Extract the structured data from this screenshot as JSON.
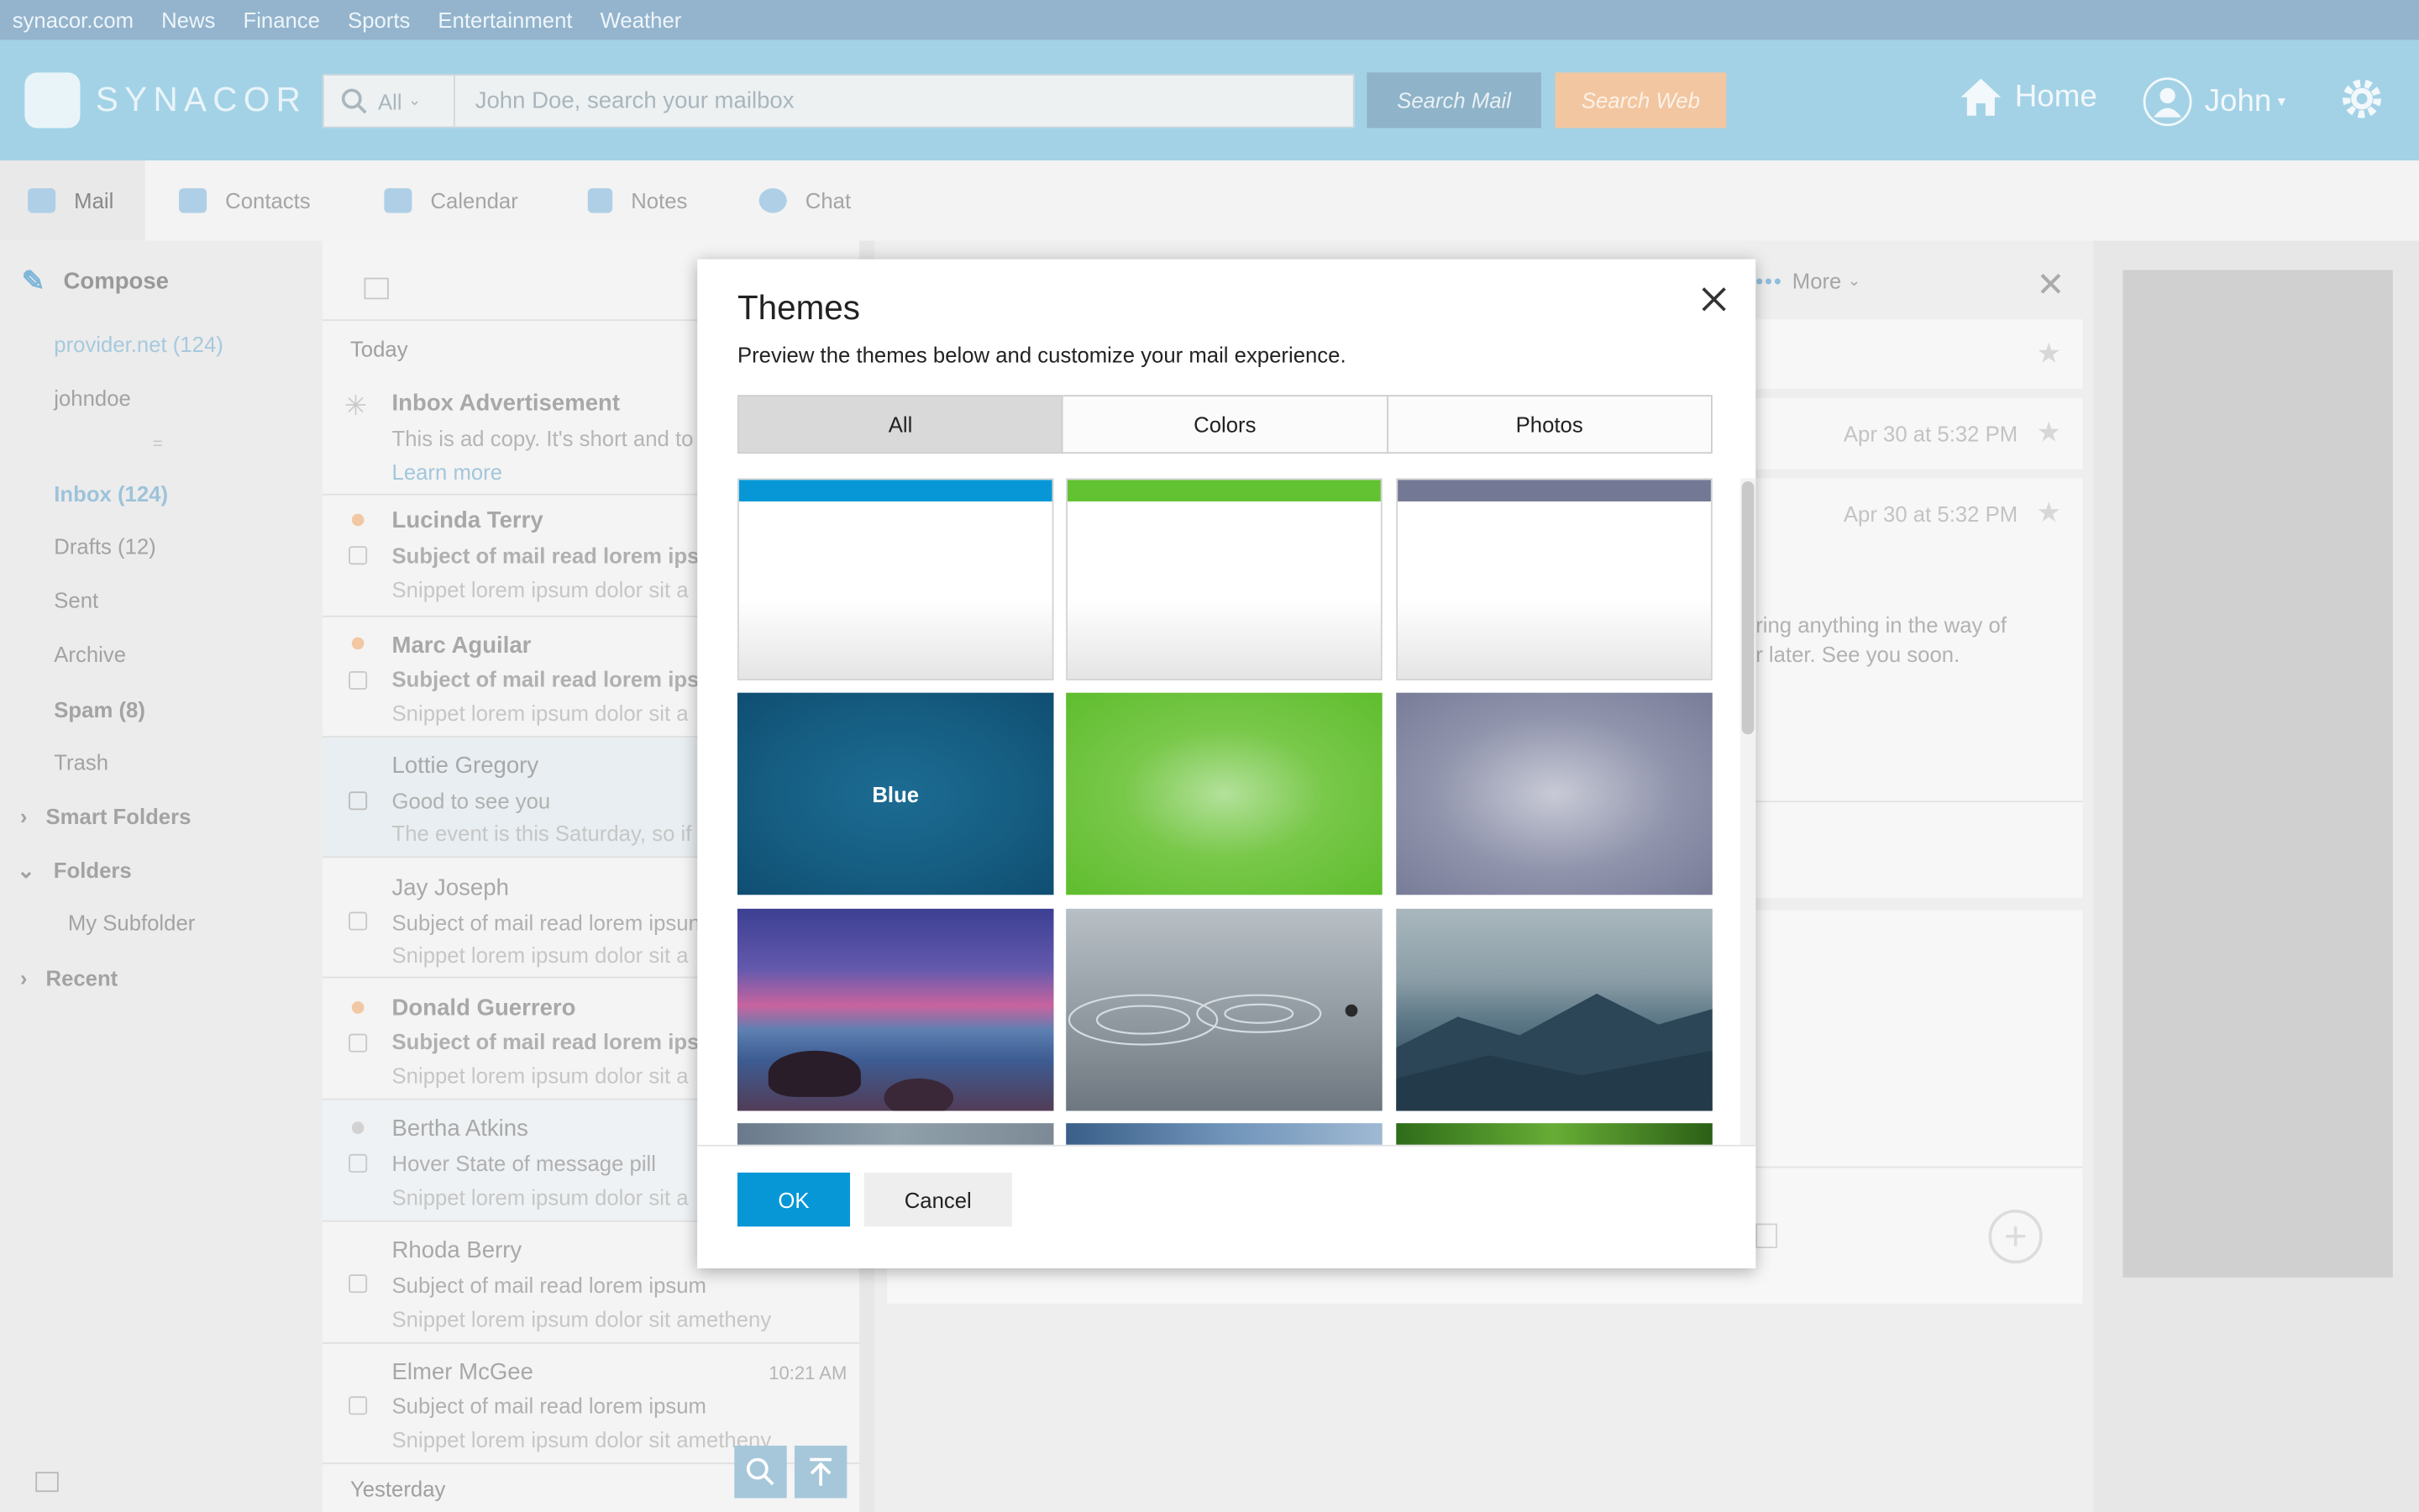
{
  "topbar": {
    "links": [
      "synacor.com",
      "News",
      "Finance",
      "Sports",
      "Entertainment",
      "Weather"
    ]
  },
  "header": {
    "logo": "SYNACOR",
    "search_scope": "All",
    "search_placeholder": "John Doe, search your mailbox",
    "search_mail": "Search Mail",
    "search_web": "Search Web",
    "home": "Home",
    "user": "John"
  },
  "apps": [
    "Mail",
    "Contacts",
    "Calendar",
    "Notes",
    "Chat"
  ],
  "sidebar": {
    "compose": "Compose",
    "accounts": [
      "provider.net (124)",
      "johndoe"
    ],
    "folders": [
      "Inbox (124)",
      "Drafts (12)",
      "Sent",
      "Archive",
      "Spam (8)",
      "Trash"
    ],
    "smart_folders": "Smart Folders",
    "folders_label": "Folders",
    "subfolder": "My Subfolder",
    "recent": "Recent"
  },
  "list": {
    "today": "Today",
    "yesterday": "Yesterday",
    "ad": {
      "name": "Inbox Advertisement",
      "text": "This is ad copy. It's short and to",
      "link": "Learn more"
    },
    "messages": [
      {
        "name": "Lucinda Terry",
        "subject": "Subject of mail read lorem ips",
        "snippet": "Snippet lorem ipsum dolor sit a"
      },
      {
        "name": "Marc Aguilar",
        "subject": "Subject of mail read lorem ips",
        "snippet": "Snippet lorem ipsum dolor sit a"
      },
      {
        "name": "Lottie Gregory",
        "subject": "Good to see you",
        "snippet": "The event is this Saturday, so if"
      },
      {
        "name": "Jay Joseph",
        "subject": "Subject of mail read lorem ipsun",
        "snippet": "Snippet lorem ipsum dolor sit a"
      },
      {
        "name": "Donald Guerrero",
        "subject": "Subject of mail read lorem ips",
        "snippet": "Snippet lorem ipsum dolor sit a"
      },
      {
        "name": "Bertha Atkins",
        "subject": "Hover State of message pill",
        "snippet": "Snippet lorem ipsum dolor sit a"
      },
      {
        "name": "Rhoda Berry",
        "subject": "Subject of mail read lorem ipsum",
        "snippet": "Snippet lorem ipsum dolor sit ametheny"
      },
      {
        "name": "Elmer McGee",
        "subject": "Subject of mail read lorem ipsum",
        "snippet": "Snippet lorem ipsum dolor sit ametheny",
        "time": "10:21 AM"
      }
    ]
  },
  "reading": {
    "more": "More",
    "date1": "Apr 30 at 5:32 PM",
    "date2": "Apr 30 at 5:32 PM",
    "body1": "ring anything in the way of",
    "body2": "r later. See you soon."
  },
  "modal": {
    "title": "Themes",
    "description": "Preview the themes below and customize your mail experience.",
    "tabs": [
      "All",
      "Colors",
      "Photos"
    ],
    "selected_tab": "All",
    "hover_label": "Blue",
    "ok": "OK",
    "cancel": "Cancel",
    "colors": {
      "blue": "#0797d7",
      "green": "#62c232",
      "gray": "#737894"
    }
  }
}
